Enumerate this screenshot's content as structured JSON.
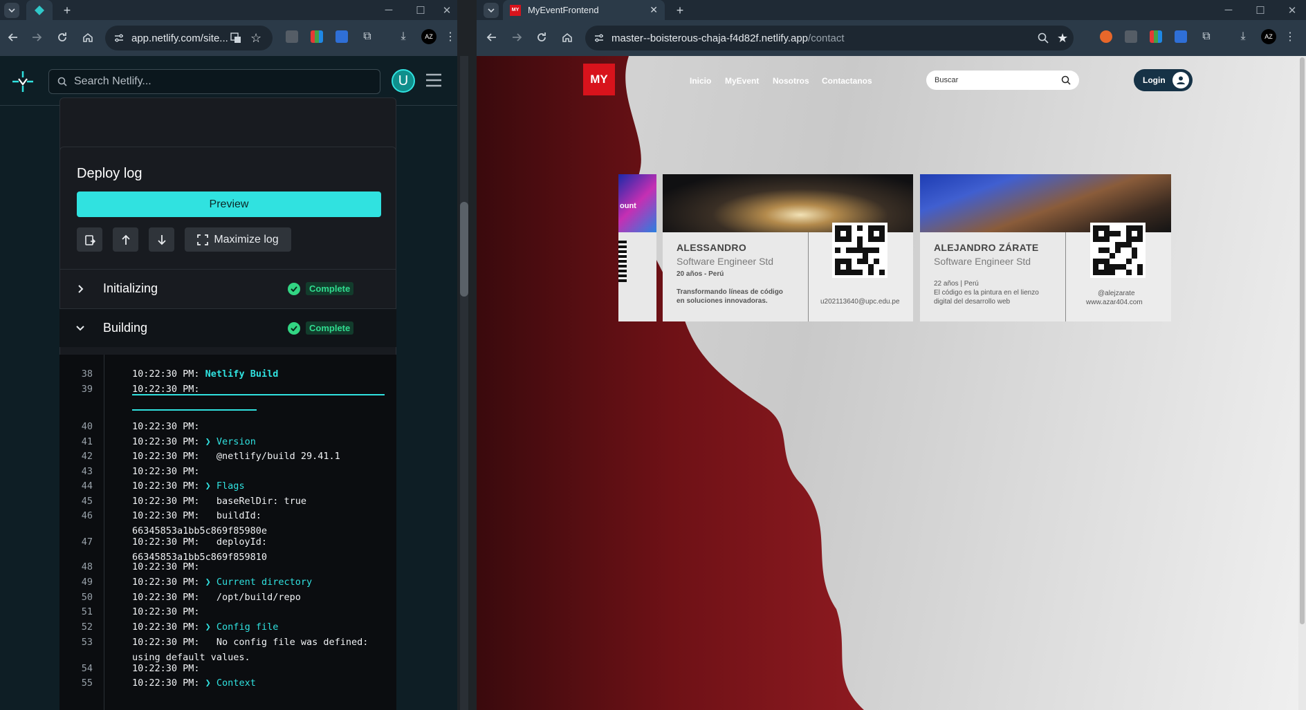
{
  "left_window": {
    "address": "app.netlify.com/site...",
    "search_placeholder": "Search Netlify...",
    "avatar_letter": "U",
    "section_title": "Deploy log",
    "preview_label": "Preview",
    "maximize_label": "Maximize log",
    "stages": [
      {
        "name": "Initializing",
        "status": "Complete"
      },
      {
        "name": "Building",
        "status": "Complete"
      }
    ],
    "log_lines": [
      {
        "n": "38",
        "t": "10:22:30 PM: ",
        "h": "Netlify Build",
        "rest": ""
      },
      {
        "n": "39",
        "t": "10:22:30 PM:",
        "h": "",
        "rest": ""
      },
      {
        "n": "40",
        "t": "10:22:30 PM:",
        "h": "",
        "rest": ""
      },
      {
        "n": "41",
        "t": "10:22:30 PM: ",
        "h": "❯ Version",
        "rest": ""
      },
      {
        "n": "42",
        "t": "10:22:30 PM:   @netlify/build 29.41.1",
        "h": "",
        "rest": ""
      },
      {
        "n": "43",
        "t": "10:22:30 PM:",
        "h": "",
        "rest": ""
      },
      {
        "n": "44",
        "t": "10:22:30 PM: ",
        "h": "❯ Flags",
        "rest": ""
      },
      {
        "n": "45",
        "t": "10:22:30 PM:   baseRelDir: true",
        "h": "",
        "rest": ""
      },
      {
        "n": "46",
        "t": "10:22:30 PM:   buildId:",
        "h": "",
        "rest": "66345853a1bb5c869f85980e"
      },
      {
        "n": "47",
        "t": "10:22:30 PM:   deployId:",
        "h": "",
        "rest": "66345853a1bb5c869f859810"
      },
      {
        "n": "48",
        "t": "10:22:30 PM:",
        "h": "",
        "rest": ""
      },
      {
        "n": "49",
        "t": "10:22:30 PM: ",
        "h": "❯ Current directory",
        "rest": ""
      },
      {
        "n": "50",
        "t": "10:22:30 PM:   /opt/build/repo",
        "h": "",
        "rest": ""
      },
      {
        "n": "51",
        "t": "10:22:30 PM:",
        "h": "",
        "rest": ""
      },
      {
        "n": "52",
        "t": "10:22:30 PM: ",
        "h": "❯ Config file",
        "rest": ""
      },
      {
        "n": "53",
        "t": "10:22:30 PM:   No config file was defined:",
        "h": "",
        "rest": "using default values."
      },
      {
        "n": "54",
        "t": "10:22:30 PM:",
        "h": "",
        "rest": ""
      },
      {
        "n": "55",
        "t": "10:22:30 PM: ",
        "h": "❯ Context",
        "rest": ""
      }
    ]
  },
  "right_window": {
    "tab_title": "MyEventFrontend",
    "address_host": "master--boisterous-chaja-f4d82f.netlify.app",
    "address_path": "/contact",
    "logo_text": "MY",
    "nav": [
      "Inicio",
      "MyEvent",
      "Nosotros",
      "Contactanos"
    ],
    "search_placeholder": "Buscar",
    "login_label": "Login",
    "partial_card_text": "ount",
    "cards": [
      {
        "name": "ALESSANDRO",
        "role": "Software Engineer Std",
        "age": "20 años - Perú",
        "quote_line1": "Transformando líneas de código",
        "quote_line2": "en soluciones innovadoras.",
        "contact1": "u202113640@upc.edu.pe",
        "contact2": ""
      },
      {
        "name": "ALEJANDRO ZÁRATE",
        "role": "Software Engineer Std",
        "age": "22 años | Perú",
        "quote_line1": "El código es la pintura en el lienzo",
        "quote_line2": "digital del desarrollo web",
        "contact1": "@alejzarate",
        "contact2": "www.azar404.com"
      }
    ]
  },
  "colors": {
    "netlify_teal": "#30e2e0",
    "complete_green": "#32d583",
    "logo_red": "#d8131c",
    "login_navy": "#163246"
  }
}
